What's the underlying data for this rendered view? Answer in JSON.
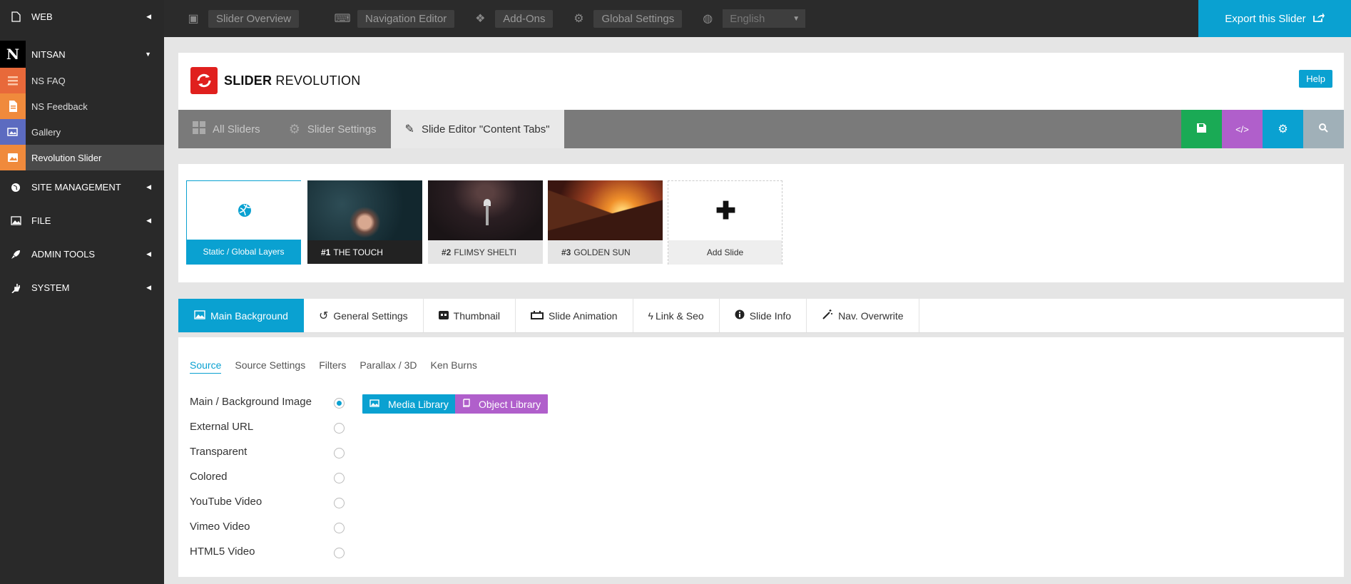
{
  "sidebar": {
    "web": "WEB",
    "nitsan": "NITSAN",
    "nitsan_logo": "N",
    "items": [
      {
        "label": "NS FAQ",
        "color": "#e8693a"
      },
      {
        "label": "NS Feedback",
        "color": "#f08a3c"
      },
      {
        "label": "Gallery",
        "color": "#5c6bc0"
      },
      {
        "label": "Revolution Slider",
        "color": "#f08a3c"
      }
    ],
    "site_management": "SITE MANAGEMENT",
    "file": "FILE",
    "admin_tools": "ADMIN TOOLS",
    "system": "SYSTEM"
  },
  "topbar": {
    "overview": "Slider Overview",
    "nav_editor": "Navigation Editor",
    "addons": "Add-Ons",
    "global_settings": "Global Settings",
    "language": "English",
    "export": "Export this Slider"
  },
  "header": {
    "logo_bold": "SLIDER",
    "logo_light": "REVOLUTION",
    "help": "Help"
  },
  "editor_tabs": {
    "all_sliders": "All Sliders",
    "slider_settings": "Slider Settings",
    "slide_editor": "Slide Editor \"Content Tabs\""
  },
  "action_colors": {
    "save": "#1aaa55",
    "code": "#b05fcb",
    "settings": "#0aa1d1",
    "search": "#a0b0b8"
  },
  "slides": {
    "static": "Static / Global Layers",
    "s1_num": "#1",
    "s1": "THE TOUCH",
    "s2_num": "#2",
    "s2": "FLIMSY SHELTI",
    "s3_num": "#3",
    "s3": "GOLDEN SUN",
    "add": "Add Slide"
  },
  "settings_tabs": {
    "main_bg": "Main Background",
    "general": "General Settings",
    "thumbnail": "Thumbnail",
    "animation": "Slide Animation",
    "link_seo": "Link & Seo",
    "info": "Slide Info",
    "nav_overwrite": "Nav. Overwrite"
  },
  "source": {
    "tabs": [
      "Source",
      "Source Settings",
      "Filters",
      "Parallax / 3D",
      "Ken Burns"
    ],
    "options": [
      "Main / Background Image",
      "External URL",
      "Transparent",
      "Colored",
      "YouTube Video",
      "Vimeo Video",
      "HTML5 Video"
    ],
    "media_library": "Media Library",
    "object_library": "Object Library"
  }
}
